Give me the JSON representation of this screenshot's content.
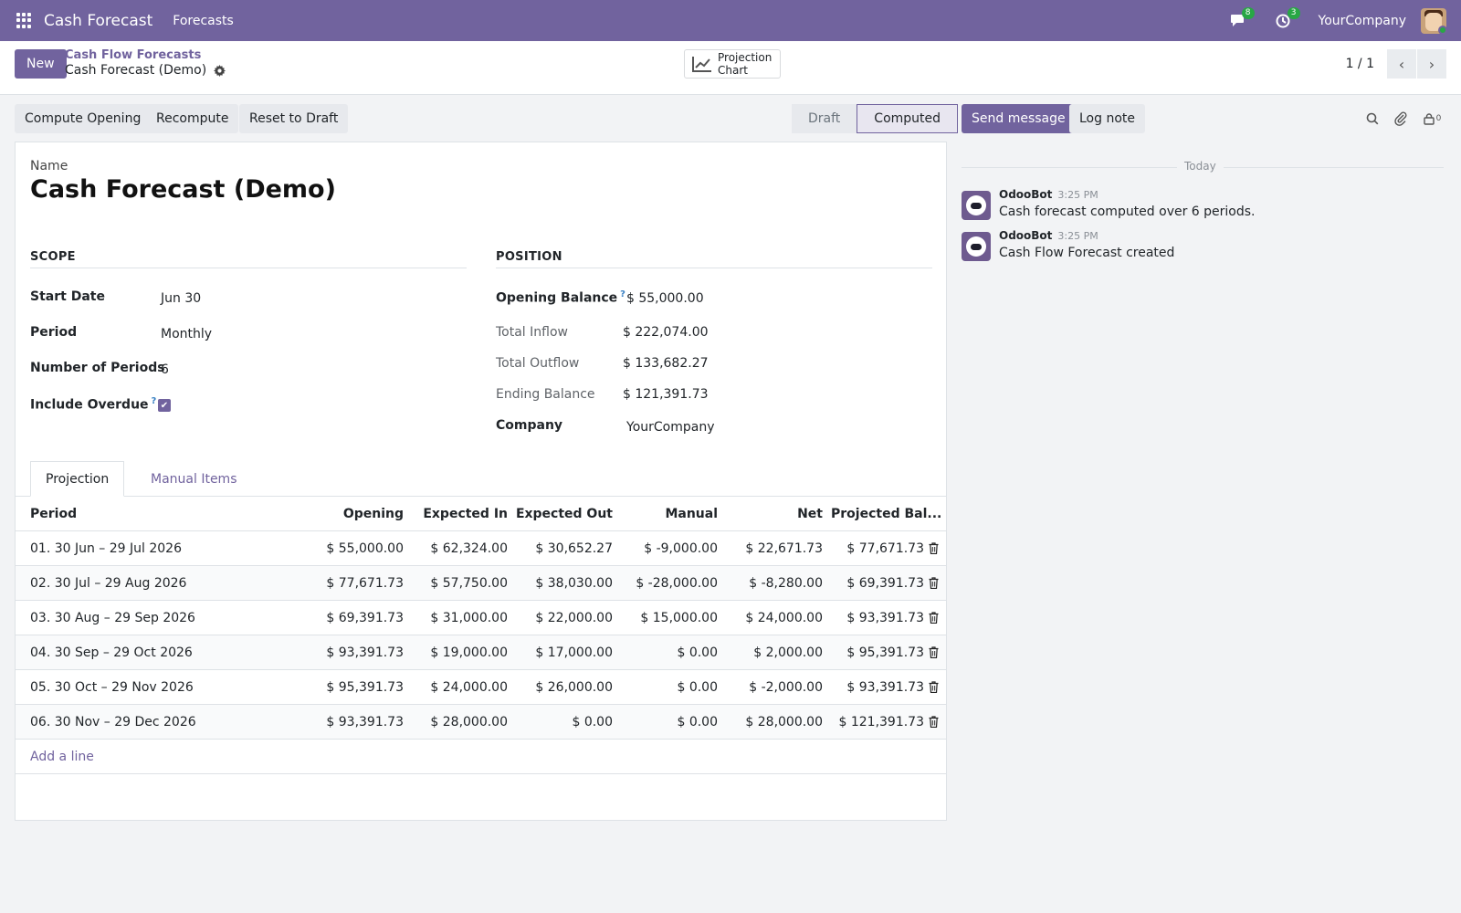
{
  "navbar": {
    "app_name": "Cash Forecast",
    "menu_forecasts": "Forecasts",
    "messages_count": "8",
    "activities_count": "3",
    "company": "YourCompany",
    "accent_color": "#71639e"
  },
  "control": {
    "new_label": "New",
    "breadcrumb_parent": "Cash Flow Forecasts",
    "breadcrumb_current": "Cash Forecast (Demo)",
    "projection_chart_line1": "Projection",
    "projection_chart_line2": "Chart",
    "pager": "1 / 1"
  },
  "actions": {
    "compute_opening": "Compute Opening",
    "recompute": "Recompute",
    "reset_to_draft": "Reset to Draft"
  },
  "status": {
    "stages": [
      "Draft",
      "Computed"
    ],
    "current": "Computed"
  },
  "form": {
    "name_label": "Name",
    "name_value": "Cash Forecast (Demo)",
    "scope_title": "SCOPE",
    "position_title": "POSITION",
    "start_date_label": "Start Date",
    "start_date_value": "Jun 30",
    "period_label": "Period",
    "period_value": "Monthly",
    "num_periods_label": "Number of Periods",
    "num_periods_value": "6",
    "include_overdue_label": "Include Overdue",
    "include_overdue_value": true,
    "opening_balance_label": "Opening Balance",
    "opening_balance_value": "$ 55,000.00",
    "total_inflow_label": "Total Inflow",
    "total_inflow_value": "$ 222,074.00",
    "total_outflow_label": "Total Outflow",
    "total_outflow_value": "$ 133,682.27",
    "ending_balance_label": "Ending Balance",
    "ending_balance_value": "$ 121,391.73",
    "company_label": "Company",
    "company_value": "YourCompany",
    "help_mark": "?"
  },
  "tabs": {
    "projection": "Projection",
    "manual_items": "Manual Items"
  },
  "table": {
    "headers": [
      "Period",
      "Opening",
      "Expected In",
      "Expected Out",
      "Manual",
      "Net",
      "Projected Bal..."
    ],
    "rows": [
      [
        "01. 30 Jun – 29 Jul 2026",
        "$ 55,000.00",
        "$ 62,324.00",
        "$ 30,652.27",
        "$ -9,000.00",
        "$ 22,671.73",
        "$ 77,671.73"
      ],
      [
        "02. 30 Jul – 29 Aug 2026",
        "$ 77,671.73",
        "$ 57,750.00",
        "$ 38,030.00",
        "$ -28,000.00",
        "$ -8,280.00",
        "$ 69,391.73"
      ],
      [
        "03. 30 Aug – 29 Sep 2026",
        "$ 69,391.73",
        "$ 31,000.00",
        "$ 22,000.00",
        "$ 15,000.00",
        "$ 24,000.00",
        "$ 93,391.73"
      ],
      [
        "04. 30 Sep – 29 Oct 2026",
        "$ 93,391.73",
        "$ 19,000.00",
        "$ 17,000.00",
        "$ 0.00",
        "$ 2,000.00",
        "$ 95,391.73"
      ],
      [
        "05. 30 Oct – 29 Nov 2026",
        "$ 95,391.73",
        "$ 24,000.00",
        "$ 26,000.00",
        "$ 0.00",
        "$ -2,000.00",
        "$ 93,391.73"
      ],
      [
        "06. 30 Nov – 29 Dec 2026",
        "$ 93,391.73",
        "$ 28,000.00",
        "$ 0.00",
        "$ 0.00",
        "$ 28,000.00",
        "$ 121,391.73"
      ]
    ],
    "add_line": "Add a line"
  },
  "chatter": {
    "send_message": "Send message",
    "log_note": "Log note",
    "followers_count": "0",
    "today": "Today",
    "messages": [
      {
        "author": "OdooBot",
        "time": "3:25 PM",
        "body": "Cash forecast computed over 6 periods."
      },
      {
        "author": "OdooBot",
        "time": "3:25 PM",
        "body": "Cash Flow Forecast created"
      }
    ]
  }
}
